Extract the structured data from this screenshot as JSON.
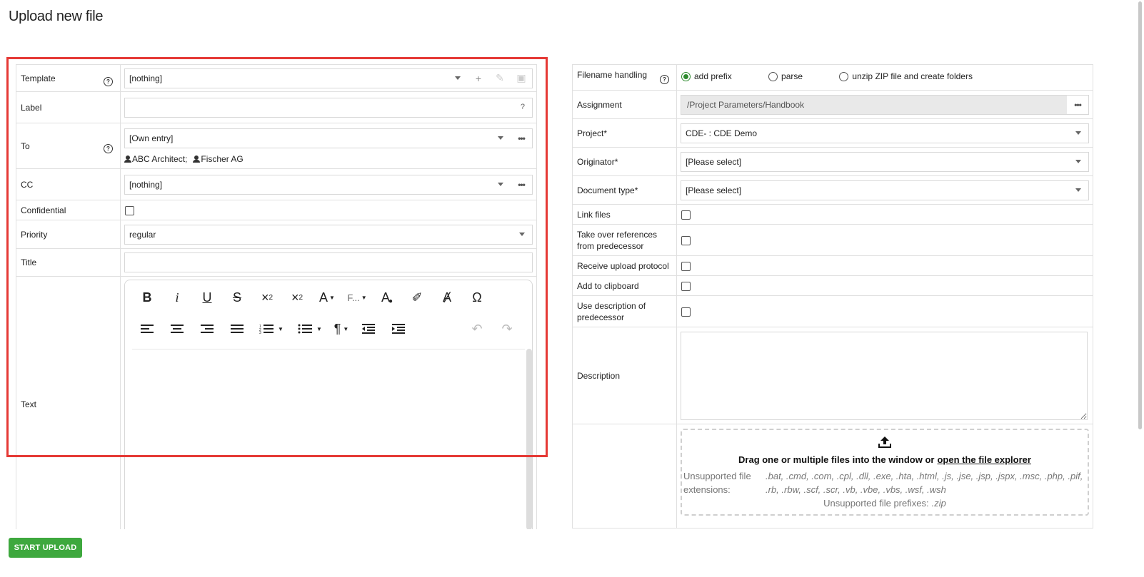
{
  "page": {
    "title": "Upload new file"
  },
  "left": {
    "template": {
      "label": "Template",
      "value": "[nothing]"
    },
    "label_field": {
      "label": "Label",
      "hint": "?"
    },
    "to": {
      "label": "To",
      "value": "[Own entry]",
      "recipients": [
        "ABC Architect;",
        "Fischer AG"
      ]
    },
    "cc": {
      "label": "CC",
      "value": "[nothing]"
    },
    "confidential": {
      "label": "Confidential"
    },
    "priority": {
      "label": "Priority",
      "value": "regular"
    },
    "title_field": {
      "label": "Title"
    },
    "text": {
      "label": "Text",
      "font_family_short": "F..."
    }
  },
  "right": {
    "filename_handling": {
      "label": "Filename handling",
      "options": [
        "add prefix",
        "parse",
        "unzip ZIP file and create folders"
      ],
      "selected": "add prefix"
    },
    "assignment": {
      "label": "Assignment",
      "value": "/Project Parameters/Handbook"
    },
    "project": {
      "label": "Project*",
      "value": "CDE- : CDE Demo"
    },
    "originator": {
      "label": "Originator*",
      "value": "[Please select]"
    },
    "document_type": {
      "label": "Document type*",
      "value": "[Please select]"
    },
    "link_files": {
      "label": "Link files"
    },
    "take_over_refs": {
      "label": "Take over references from predecessor"
    },
    "receive_protocol": {
      "label": "Receive upload protocol"
    },
    "add_clipboard": {
      "label": "Add to clipboard"
    },
    "use_description": {
      "label": "Use description of predecessor"
    },
    "description": {
      "label": "Description"
    },
    "dropzone": {
      "main_text": "Drag one or multiple files into the window or",
      "link_text": "open the file explorer",
      "unsupported_ext_label": "Unsupported file extensions:",
      "unsupported_ext_value": ".bat, .cmd, .com, .cpl, .dll, .exe, .hta, .html, .js, .jse, .jsp, .jspx, .msc, .php, .pif, .rb, .rbw, .scf, .scr, .vb, .vbe, .vbs, .wsf, .wsh",
      "unsupported_prefix_label": "Unsupported file prefixes:",
      "unsupported_prefix_value": ".zip"
    }
  },
  "actions": {
    "start_upload": "START UPLOAD"
  },
  "colors": {
    "highlight": "#e53935",
    "primary_button": "#3ea83e",
    "radio_selected": "#2e8b2e"
  }
}
